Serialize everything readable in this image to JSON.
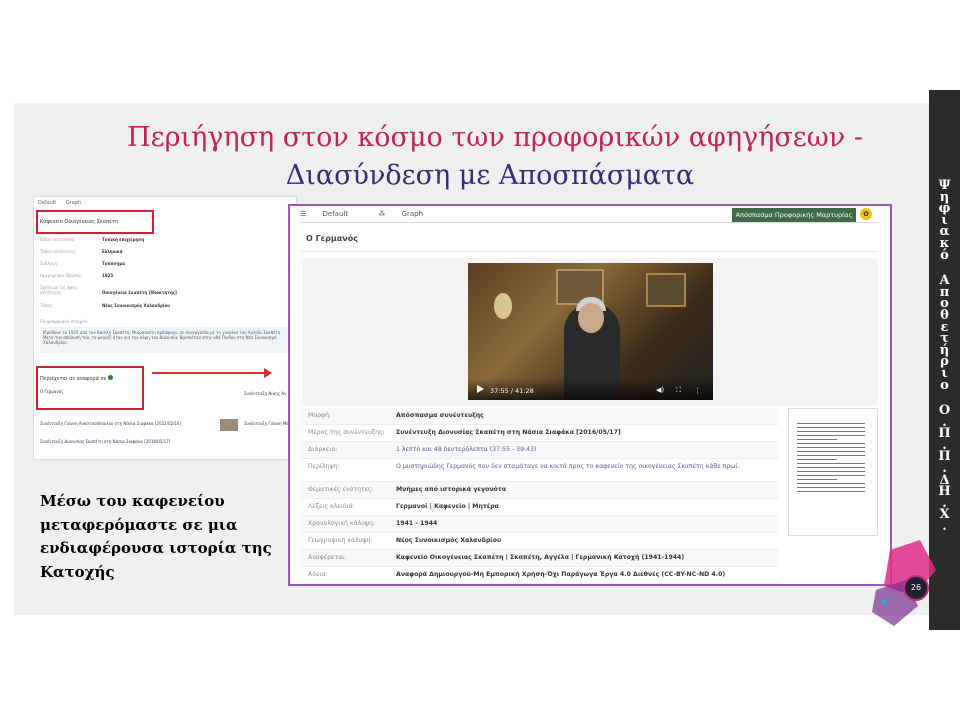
{
  "slide": {
    "title_line1": "Περιήγηση στον κόσμο των προφορικών αφηγήσεων  -",
    "title_line2": "Διασύνδεση με Αποσπάσματα",
    "side_label_words": [
      "Ψηφιακό",
      "Αποθετήριο",
      "Ο.Π.Π.ΔΗ.Χ."
    ],
    "body_text": "Μέσω του καφενείου μεταφερόμαστε  σε μια ενδιαφέρουσα ιστορία της Κατοχής",
    "page_number": "26",
    "colors": {
      "title_pink": "#c0235a",
      "title_purple": "#3a2a7a",
      "highlight_red": "#cc2233",
      "frame_purple": "#9b59b6"
    }
  },
  "left_screenshot": {
    "tabs": [
      "Default",
      "Graph"
    ],
    "place_title": "Καφενείο Οικογένειας Σκαπέτη",
    "meta": [
      {
        "k": "Είδος οντότητας:",
        "v": "Τοπική επιχείρηση"
      },
      {
        "k": "Τύπος οντότητας:",
        "v": "Ελληνικά"
      },
      {
        "k": "Συλλογή:",
        "v": "Τοπόσημα"
      },
      {
        "k": "Ημερομηνία ίδρυσης:",
        "v": "1925"
      },
      {
        "k": "Σχέση με τις αφηγ. οντότητες:",
        "v": "Οικογένεια Σκαπέτη [Ιδιοκτήτης]"
      },
      {
        "k": "Τόπος:",
        "v": "Νέος Συνοικισμός Χαλανδρίου"
      }
    ],
    "desc_title": "Πληροφοριακό στοιχείο",
    "desc_text": "Ιδρύθηκε το 1925 από τον Βασίλη Σκαπέτη, Μικρασιάτη πρόσφυγα, σε συνεργασία με τη γυναίκα του Αγλαΐα Σκαπέτη. Μετά την απόλυσή του, το μαγαζί ήταν για την κόρη του Διονυσία. Βρισκόταν στην οδό Πινδου στη Νέο Συνοικισμό Χαλανδρίου.",
    "ref_title": "Περιέχεται σε αναφορά σε",
    "ref_item": "Ο Γερμανός",
    "ref_side": "Συνέντευξη Νίκης Αν",
    "rows": [
      {
        "text": "Συνέντευξη Γιάννη Αναστασόπουλου στη Νάσια Σιαφάκα [2022/02/16]",
        "side": "Συνέντευξη Γιάννη Με"
      },
      {
        "text": "Συνέντευξη Διονυσίας Σκαπέτη στη Νάσια Σιαφάκα [2016/05/17]",
        "side": ""
      }
    ]
  },
  "main_screenshot": {
    "tabs": [
      "Default",
      "Graph"
    ],
    "action_button": "Απόσπασμα Προφορικής Μαρτυρίας",
    "page_title": "Ο Γερμανός",
    "video": {
      "time": "37:55 / 41:28",
      "icons": [
        "play-icon",
        "volume-icon",
        "fullscreen-icon",
        "more-icon"
      ]
    },
    "meta": [
      {
        "k": "Μορφή:",
        "v": "Απόσπασμα συνέντευξης"
      },
      {
        "k": "Μέρος της συνέντευξης:",
        "v": "Συνέντευξη Διονυσίας Σκαπέτη στη Νάσια Σιαφάκα [2016/05/17]"
      },
      {
        "k": "Διάρκεια:",
        "v": "1 λεπτό και 48 δευτερόλεπτα (37:55 - 39:43)"
      },
      {
        "k": "Περίληψη:",
        "v": "Ο μυστηριώδης Γερμανός που δεν σταμάταγε να κοιτά προς το καφενείο της οικογένειας Σκαπέτη κάθε πρωί."
      },
      {
        "k": "Θεματικές ενότητες:",
        "v": "Μνήμες από ιστορικά γεγονότα"
      },
      {
        "k": "Λέξεις κλειδιά:",
        "v": "Γερμανοί  |  Καφενείο  |  Μητέρα"
      },
      {
        "k": "Χρονολογική κάλυψη:",
        "v": "1941 - 1944"
      },
      {
        "k": "Γεωγραφική κάλυψη:",
        "v": "Νέος Συνοικισμός Χαλανδρίου"
      },
      {
        "k": "Αναφέρεται:",
        "v": "Καφενείο Οικογένειας Σκαπέτη  |  Σκαπέτη, Αγγέλα  |  Γερμανική Κατοχή (1941-1944)"
      },
      {
        "k": "Άδεια:",
        "v": "Αναφορά Δημιουργού-Μη Εμπορική Χρήση-Όχι Παράγωγα Έργα 4.0 Διεθνές (CC-BY-NC-ND 4.0)"
      }
    ]
  }
}
